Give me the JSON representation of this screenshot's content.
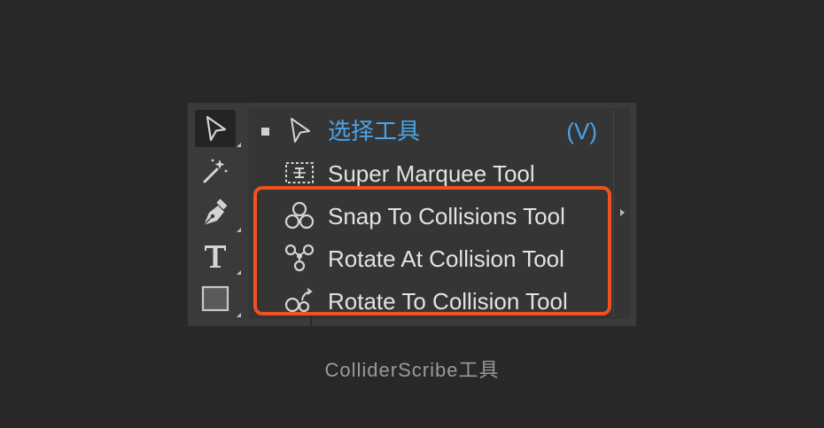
{
  "menu": {
    "items": [
      {
        "label": "选择工具",
        "shortcut": "(V)",
        "icon": "selection-arrow-icon",
        "checked": true
      },
      {
        "label": "Super Marquee Tool",
        "icon": "super-marquee-icon"
      },
      {
        "label": "Snap To Collisions Tool",
        "icon": "snap-collisions-icon"
      },
      {
        "label": "Rotate At Collision Tool",
        "icon": "rotate-at-collision-icon"
      },
      {
        "label": "Rotate To Collision Tool",
        "icon": "rotate-to-collision-icon"
      }
    ]
  },
  "toolbar": {
    "tools": [
      "selection-arrow-icon",
      "magic-wand-icon",
      "pen-icon",
      "type-icon",
      "rectangle-icon"
    ]
  },
  "caption": "ColliderScribe工具",
  "colors": {
    "highlight_border": "#f05022",
    "accent_text": "#4aa3e8"
  }
}
